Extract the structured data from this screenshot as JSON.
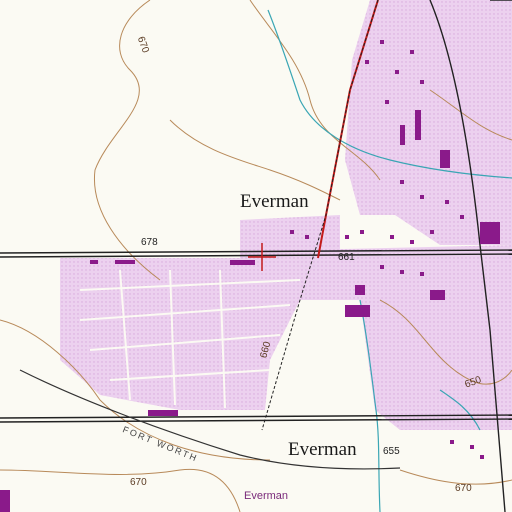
{
  "place_labels": {
    "town_north": "Everman",
    "town_south": "Everman",
    "town_small": "Everman"
  },
  "elevation_labels": {
    "e670_nw": "670",
    "e678_road": "678",
    "e661_road": "661",
    "e660_curve": "660",
    "e650_east": "650",
    "e655_south": "655",
    "e670_sw": "670",
    "e670_se": "670"
  },
  "railroad_label": "FORT WORTH",
  "colors": {
    "paper": "#fbfaf3",
    "contour": "#b88a5a",
    "urban_tint": "#e9c9ec",
    "building": "#8a1a8a",
    "water": "#3aa6b4",
    "road": "#222222",
    "highway": "#c21a1a"
  },
  "marker": {
    "icon": "survey-crosshair-icon",
    "color": "#c21a1a"
  }
}
